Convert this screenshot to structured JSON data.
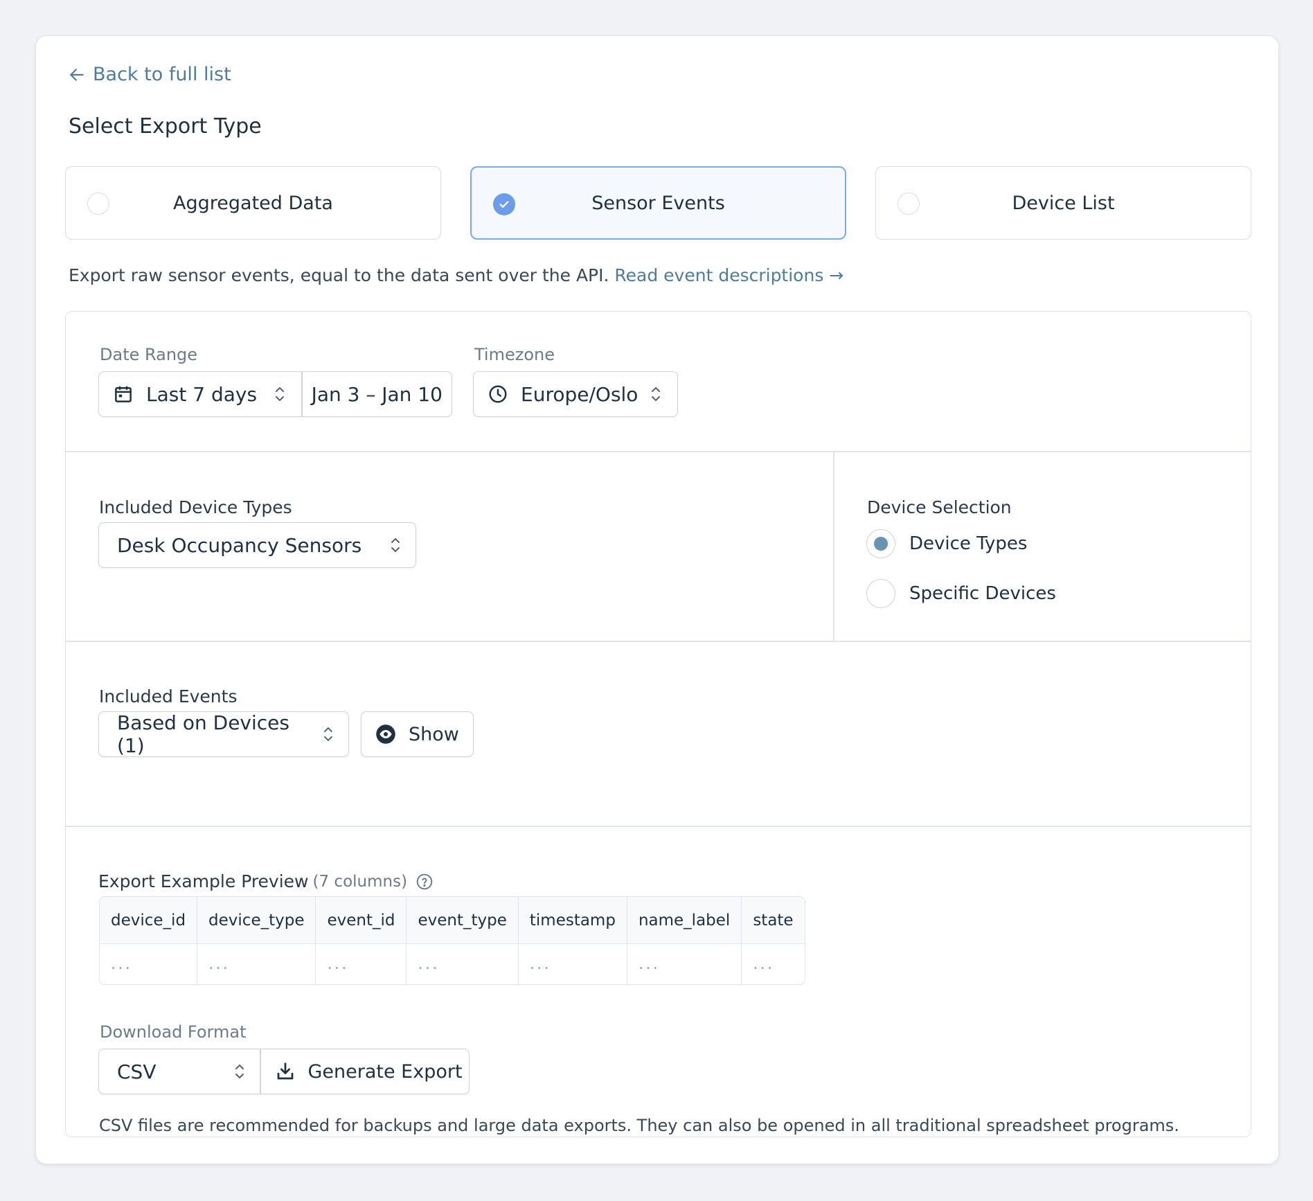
{
  "nav": {
    "back_label": "Back to full list"
  },
  "export_type": {
    "title": "Select Export Type",
    "options": [
      {
        "label": "Aggregated Data",
        "selected": false
      },
      {
        "label": "Sensor Events",
        "selected": true
      },
      {
        "label": "Device List",
        "selected": false
      }
    ],
    "description": "Export raw sensor events, equal to the data sent over the API.",
    "description_link": "Read event descriptions →"
  },
  "date_range": {
    "label": "Date Range",
    "preset": "Last 7 days",
    "range": "Jan 3 – Jan 10"
  },
  "timezone": {
    "label": "Timezone",
    "value": "Europe/Oslo"
  },
  "device_types": {
    "label": "Included Device Types",
    "value": "Desk Occupancy Sensors"
  },
  "device_selection": {
    "label": "Device Selection",
    "options": [
      {
        "label": "Device Types",
        "selected": true
      },
      {
        "label": "Specific Devices",
        "selected": false
      }
    ]
  },
  "events": {
    "label": "Included Events",
    "value": "Based on Devices (1)",
    "show_label": "Show"
  },
  "preview": {
    "title": "Export Example Preview",
    "count": "(7 columns)",
    "columns": [
      "device_id",
      "device_type",
      "event_id",
      "event_type",
      "timestamp",
      "name_label",
      "state"
    ],
    "placeholder": "..."
  },
  "download": {
    "label": "Download Format",
    "format": "CSV",
    "generate_label": "Generate Export",
    "note": "CSV files are recommended for backups and large data exports. They can also be opened in all traditional spreadsheet programs."
  },
  "colors": {
    "accent": "#6c9deb",
    "link": "#4f7c9c",
    "radio_dot": "#6893b4"
  }
}
